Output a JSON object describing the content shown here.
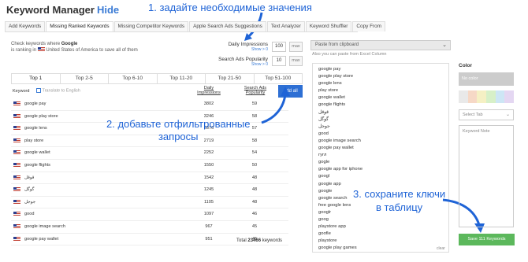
{
  "header": {
    "title": "Keyword Manager",
    "hide_link": "Hide"
  },
  "annotations": {
    "step1": "1. задайте необходимые значения",
    "step2": "2. добавьте отфильтрованные\nзапросы",
    "step3": "3. сохраните ключи\nв таблицу"
  },
  "tabs": [
    "Add Keywords",
    "Missing Ranked Keywords",
    "Missing Competitor Keywords",
    "Apple Search Ads Suggestions",
    "Text Analyzer",
    "Keyword Shuffler",
    "Copy From"
  ],
  "check": {
    "line1_prefix": "Check keywords where ",
    "app": "Google",
    "line2_prefix": "is ranking in ",
    "country": "United States of America",
    "line2_suffix": "to save all of them"
  },
  "filters": {
    "daily_label": "Daily Impressions",
    "daily_show": "Show > 0",
    "daily_value": "100",
    "daily_max": "max",
    "pop_label": "Search Ads Popularity",
    "pop_show": "Show > 0",
    "pop_value": "10",
    "pop_max": "max"
  },
  "paste": {
    "select": "Paste from clipboard",
    "hint": "Also you can paste from Excel Column"
  },
  "rank_tabs": [
    "Top 1",
    "Top 2-5",
    "Top 6-10",
    "Top 11-20",
    "Top 21-50",
    "Top 51-100"
  ],
  "table": {
    "col_keyword": "Keyword",
    "translate": "Translate to English",
    "col_daily": "Daily Impressions",
    "col_pop": "Search Ads Popularity",
    "add_all": "Add all",
    "rows": [
      {
        "kw": "google pay",
        "imp": "3802",
        "pop": "59"
      },
      {
        "kw": "google play store",
        "imp": "3246",
        "pop": "58"
      },
      {
        "kw": "google lens",
        "imp": "2876",
        "pop": "57"
      },
      {
        "kw": "play store",
        "imp": "2719",
        "pop": "58"
      },
      {
        "kw": "google wallet",
        "imp": "2252",
        "pop": "54"
      },
      {
        "kw": "google flights",
        "imp": "1550",
        "pop": "50"
      },
      {
        "kw": "قوقل",
        "imp": "1542",
        "pop": "48"
      },
      {
        "kw": "گوگل",
        "imp": "1245",
        "pop": "48"
      },
      {
        "kw": "جوجل",
        "imp": "1105",
        "pop": "48"
      },
      {
        "kw": "good",
        "imp": "1097",
        "pop": "46"
      },
      {
        "kw": "google image search",
        "imp": "967",
        "pop": "45"
      },
      {
        "kw": "google pay wallet",
        "imp": "951",
        "pop": "45"
      }
    ],
    "total_label": "Total",
    "total_value": "23466",
    "total_suffix": "keywords"
  },
  "keyword_list": [
    "google pay",
    "google play store",
    "google lens",
    "play store",
    "google wallet",
    "google flights",
    "قوقل",
    "گوگل",
    "جوجل",
    "good",
    "google image search",
    "google pay wallet",
    "гугл",
    "gogle",
    "google app for iphone",
    "googl",
    "google app",
    "google",
    "google search",
    "free google lens",
    "googlr",
    "goog",
    "playstore app",
    "goofle",
    "playstore",
    "google play games"
  ],
  "clear": "clear",
  "sidebar": {
    "color_label": "Color",
    "no_color": "No color",
    "swatches": [
      "#e9e9e9",
      "#f6d8c6",
      "#f5f0c4",
      "#d7f0c8",
      "#cde6f5",
      "#e4d7f2"
    ],
    "select_tab": "Select Tab",
    "note_placeholder": "Keyword Note",
    "save_button": "Save 111 Keywords"
  },
  "colors": {
    "accent": "#2d6fd4",
    "annotation": "#1e63d6",
    "save": "#5cb85c"
  }
}
